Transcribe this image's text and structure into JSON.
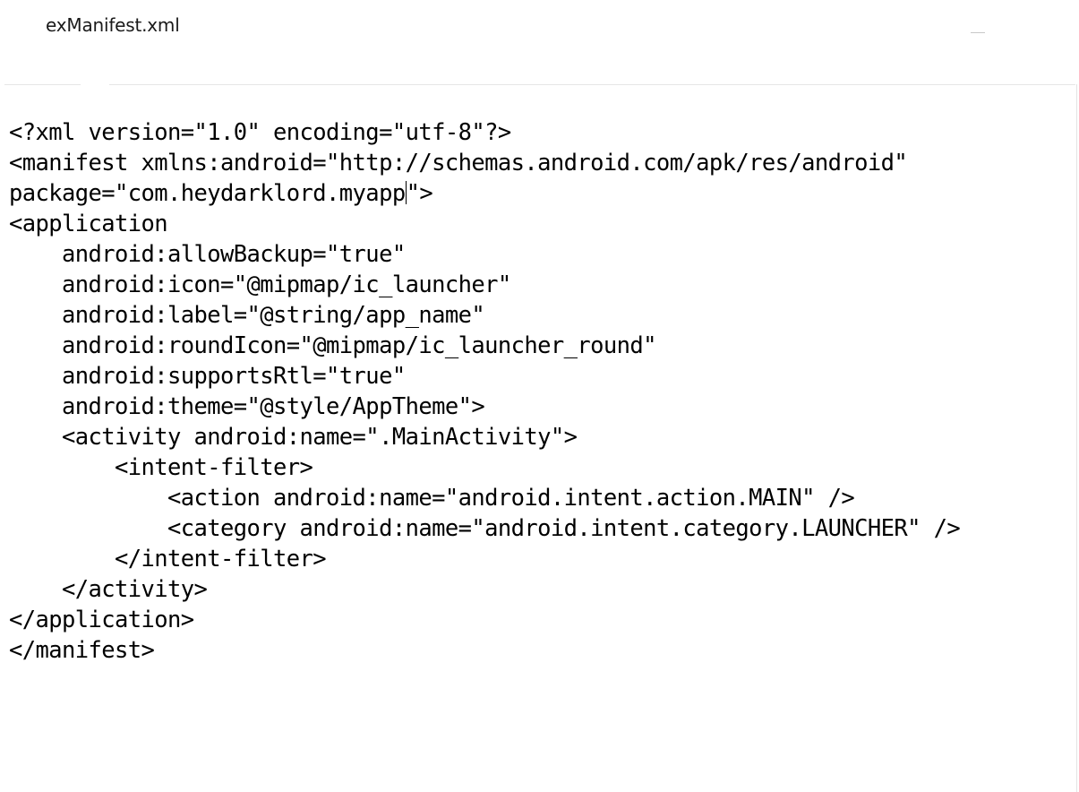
{
  "window": {
    "title": "exManifest.xml"
  },
  "editor": {
    "lines": [
      "<?xml version=\"1.0\" encoding=\"utf-8\"?>",
      "<manifest xmlns:android=\"http://schemas.android.com/apk/res/android\"",
      "package=\"com.heydarklord.myapp\">",
      "<application",
      "    android:allowBackup=\"true\"",
      "    android:icon=\"@mipmap/ic_launcher\"",
      "    android:label=\"@string/app_name\"",
      "    android:roundIcon=\"@mipmap/ic_launcher_round\"",
      "    android:supportsRtl=\"true\"",
      "    android:theme=\"@style/AppTheme\">",
      "    <activity android:name=\".MainActivity\">",
      "        <intent-filter>",
      "            <action android:name=\"android.intent.action.MAIN\" />",
      "            <category android:name=\"android.intent.category.LAUNCHER\" />",
      "        </intent-filter>",
      "    </activity>",
      "</application>",
      "</manifest>"
    ],
    "caret_line": 2,
    "caret_after": "package=\"com.heydarklord.myapp",
    "caret_rest": "\">"
  }
}
